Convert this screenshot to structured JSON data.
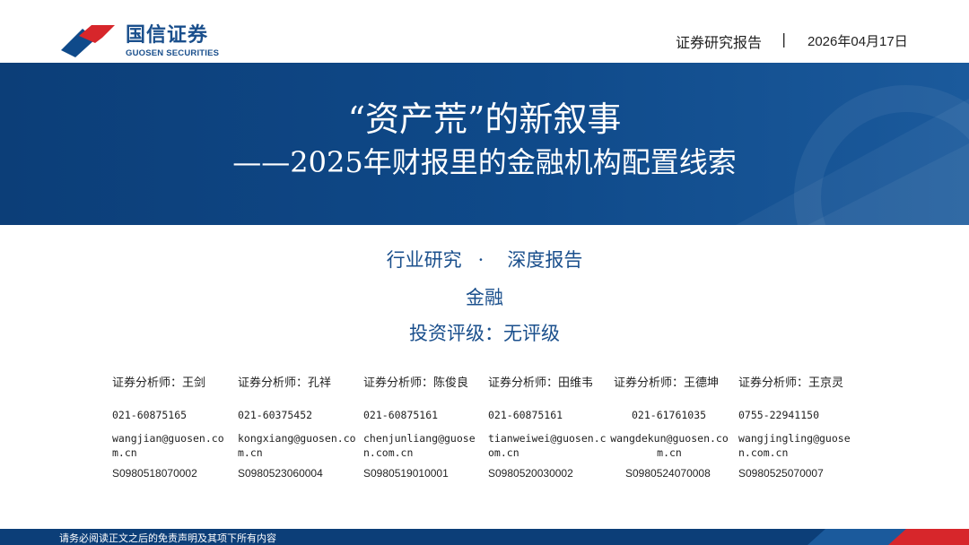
{
  "header": {
    "logo_cn": "国信证券",
    "logo_en": "GUOSEN SECURITIES",
    "report_type": "证券研究报告",
    "separator": "|",
    "date": "2026年04月17日"
  },
  "title": {
    "line1": "“资产荒”的新叙事",
    "line2": "——2025年财报里的金融机构配置线索"
  },
  "subheadings": {
    "category": "行业研究",
    "dot": "·",
    "report_kind": "深度报告",
    "industry": "金融",
    "rating": "投资评级：无评级"
  },
  "analysts": [
    {
      "name": "证券分析师：王剑",
      "phone": "021-60875165",
      "email": "wangjian@guosen.com.cn",
      "cert": "S0980518070002"
    },
    {
      "name": "证券分析师：孔祥",
      "phone": "021-60375452",
      "email": "kongxiang@guosen.com.cn",
      "cert": "S0980523060004"
    },
    {
      "name": "证券分析师：陈俊良",
      "phone": "021-60875161",
      "email": "chenjunliang@guosen.com.cn",
      "cert": "S0980519010001"
    },
    {
      "name": "证券分析师：田维韦",
      "phone": "021-60875161",
      "email": "tianweiwei@guosen.com.cn",
      "cert": "S0980520030002"
    },
    {
      "name": "证券分析师：王德坤",
      "phone": "021-61761035",
      "email": "wangdekun@guosen.com.cn",
      "cert": "S0980524070008"
    },
    {
      "name": "证券分析师：王京灵",
      "phone": "0755-22941150",
      "email": "wangjingling@guosen.com.cn",
      "cert": "S0980525070007"
    }
  ],
  "footer": {
    "disclaimer": "请务必阅读正文之后的免责声明及其项下所有内容"
  },
  "colors": {
    "brand_blue": "#0f4a8a",
    "brand_red": "#d7262b"
  }
}
